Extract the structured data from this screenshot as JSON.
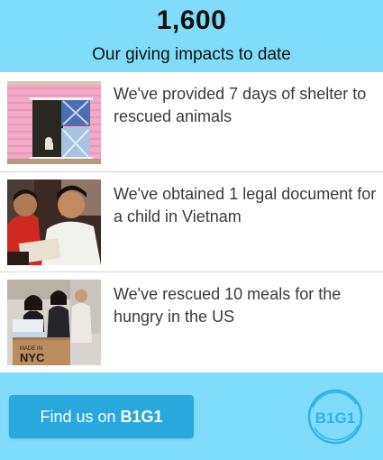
{
  "header": {
    "count": "1,600",
    "subtitle": "Our giving impacts to date"
  },
  "impacts": [
    {
      "text": "We've provided 7 days of shelter to rescued animals",
      "image": "pink-animal-shelter-photo"
    },
    {
      "text": "We've obtained 1 legal document for a child in Vietnam",
      "image": "vietnamese-children-photo"
    },
    {
      "text": "We've rescued 10 meals for the hungry in the US",
      "image": "volunteers-nyc-box-photo",
      "image_box_text": "MADE IN NYC"
    }
  ],
  "footer": {
    "button_prefix": "Find us on ",
    "button_brand": "B1G1",
    "logo_text": "B1G1"
  },
  "colors": {
    "background": "#7fdcfb",
    "button": "#29a8de",
    "logo": "#2fb3e8"
  }
}
